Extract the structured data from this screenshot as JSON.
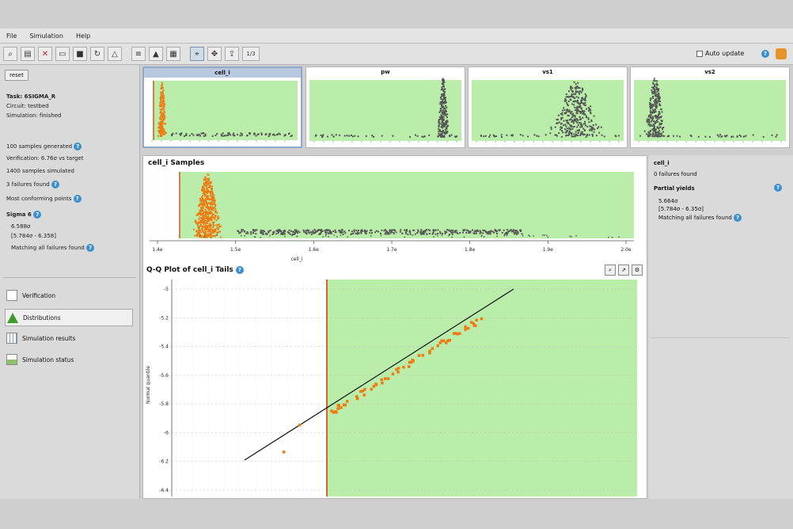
{
  "menu": [
    "File",
    "Simulation",
    "Help"
  ],
  "toolbar": {
    "page_counter": "1/3",
    "auto_update_label": "Auto update"
  },
  "left": {
    "reset_label": "reset",
    "info": [
      "Task: 6SIGMA_R",
      "Circuit: testbed",
      "Simulation: finished"
    ],
    "stats": [
      {
        "text": "100 samples generated",
        "help": true
      },
      {
        "text": "Verification: 6.76σ vs target",
        "help": false
      },
      {
        "text": "1400 samples simulated",
        "help": false
      },
      {
        "text": "3 failures found",
        "help": true
      },
      {
        "text": "Most conforming points",
        "help": true
      }
    ],
    "sigma_title": "Sigma 6",
    "sigma_lines": [
      "6.588σ",
      "[5.784σ - 6.358]",
      "Matching all failures found"
    ],
    "nav": [
      {
        "label": "Verification",
        "icon": "verification-icon",
        "active": false
      },
      {
        "label": "Distributions",
        "icon": "distributions-icon",
        "active": true
      },
      {
        "label": "Simulation results",
        "icon": "results-table-icon",
        "active": false
      },
      {
        "label": "Simulation status",
        "icon": "status-icon",
        "active": false
      }
    ]
  },
  "thumbs": [
    {
      "title": "cell_i",
      "active": true
    },
    {
      "title": "pw",
      "active": false
    },
    {
      "title": "vs1",
      "active": false
    },
    {
      "title": "vs2",
      "active": false
    }
  ],
  "samples_panel": {
    "title": "cell_i Samples",
    "xticks": [
      "1.4e",
      "1.5e",
      "1.6e",
      "1.7e",
      "1.8e",
      "1.9e",
      "2.0e"
    ],
    "xlabel": "cell_i"
  },
  "qq_panel": {
    "title": "Q-Q Plot of cell_i Tails",
    "ylabel": "Normal quantile",
    "yticks": [
      "-5",
      "-5.2",
      "-5.4",
      "-5.6",
      "-5.8",
      "-6",
      "-6.2",
      "-6.4"
    ]
  },
  "right": {
    "title": "cell_i",
    "line1": "0 failures found",
    "sub_title": "Partial yields",
    "lines": [
      "5.664σ",
      "[5.784σ - 6.35σ]",
      "Matching all failures found"
    ]
  },
  "colors": {
    "pass_region": "#b9eda9",
    "fail_marker": "#d8541a",
    "fail_points": "#f07a10",
    "sample_points": "#555555",
    "fit_line": "#111111"
  }
}
